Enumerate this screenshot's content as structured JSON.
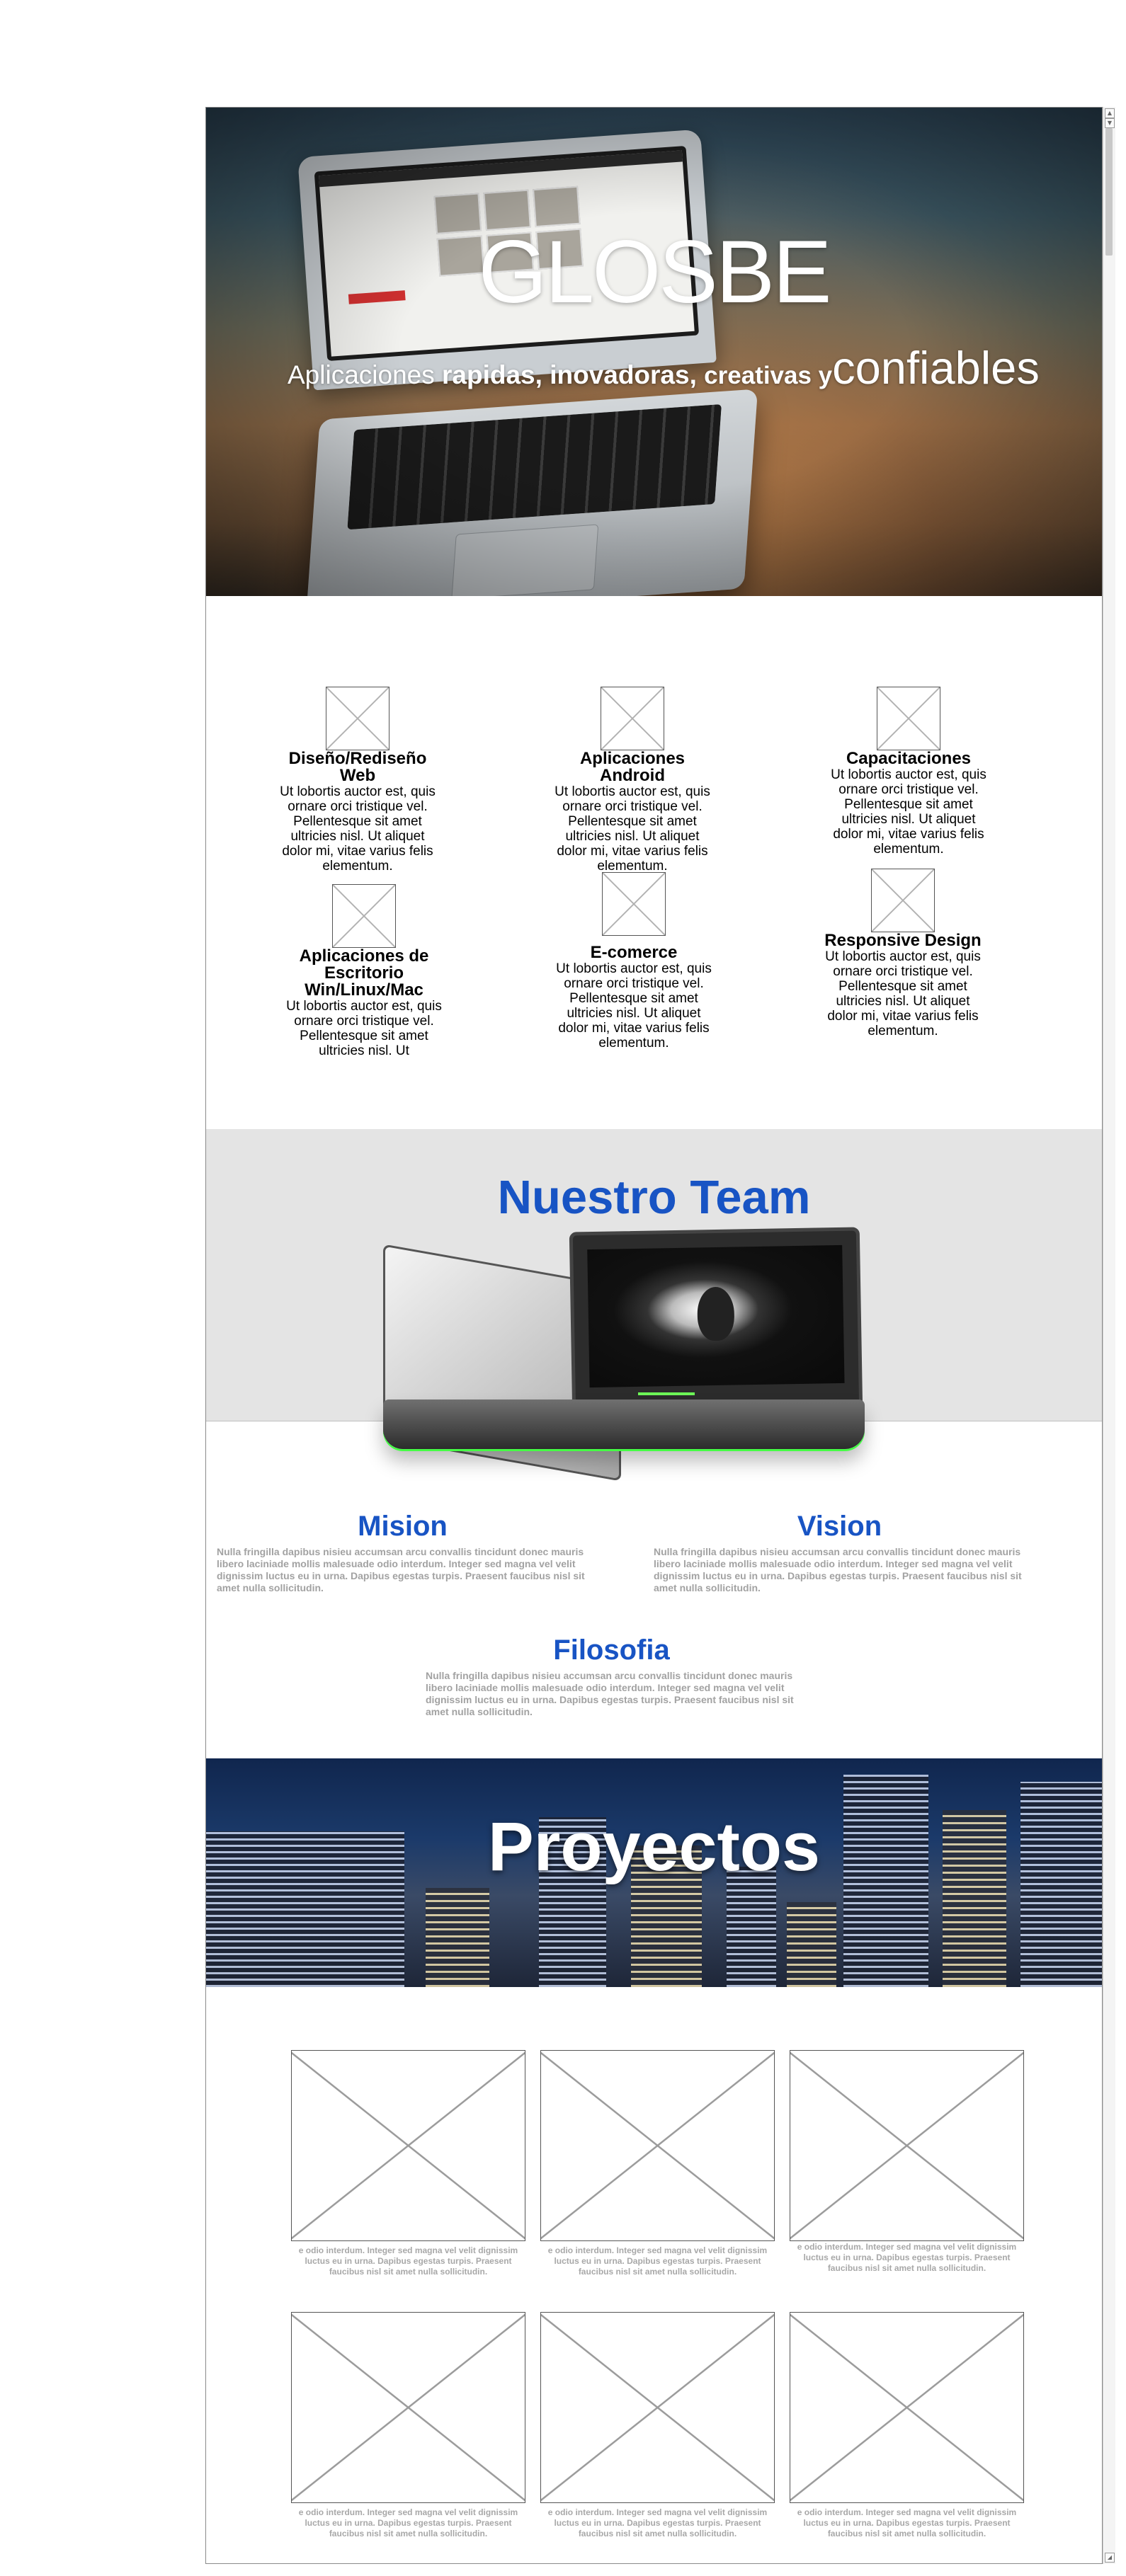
{
  "hero": {
    "title": "GLOSBE",
    "subtitle_part1": "Aplicaciones ",
    "subtitle_part2": "rapidas, inovadoras, ",
    "subtitle_part3": "creativas y",
    "subtitle_part4": "confiables"
  },
  "services": [
    {
      "title": "Diseño/Rediseño Web",
      "text": "Ut lobortis auctor est, quis ornare orci tristique vel. Pellentesque sit amet ultricies nisl. Ut aliquet dolor mi, vitae varius felis elementum."
    },
    {
      "title": "Aplicaciones Android",
      "text": "Ut lobortis auctor est, quis ornare orci tristique vel. Pellentesque sit amet ultricies nisl. Ut aliquet dolor mi, vitae varius felis elementum."
    },
    {
      "title": "Capacitaciones",
      "text": "Ut lobortis auctor est, quis ornare orci tristique vel. Pellentesque sit amet ultricies nisl. Ut aliquet dolor mi, vitae varius felis elementum."
    },
    {
      "title": "Aplicaciones de Escritorio Win/Linux/Mac",
      "text": "Ut lobortis auctor est, quis ornare orci tristique vel. Pellentesque sit amet ultricies nisl. Ut"
    },
    {
      "title": "E-comerce",
      "text": "Ut lobortis auctor est, quis ornare orci tristique vel. Pellentesque sit amet ultricies nisl. Ut aliquet dolor mi, vitae varius felis elementum."
    },
    {
      "title": "Responsive Design",
      "text": "Ut lobortis auctor est, quis ornare orci tristique vel. Pellentesque sit amet ultricies nisl. Ut aliquet dolor mi, vitae varius felis elementum."
    }
  ],
  "team": {
    "title": "Nuestro Team",
    "mision": {
      "title": "Mision",
      "text": "Nulla fringilla dapibus nisieu accumsan arcu convallis tincidunt donec mauris libero laciniade mollis malesuade odio interdum. Integer sed magna vel velit dignissim luctus eu in urna. Dapibus egestas turpis. Praesent faucibus nisl sit amet nulla sollicitudin."
    },
    "vision": {
      "title": "Vision",
      "text": "Nulla fringilla dapibus nisieu accumsan arcu convallis tincidunt donec mauris libero laciniade mollis malesuade odio interdum. Integer sed magna vel velit dignissim luctus eu in urna. Dapibus egestas turpis. Praesent faucibus nisl sit amet nulla sollicitudin."
    },
    "filosofia": {
      "title": "Filosofia",
      "text": "Nulla fringilla dapibus nisieu accumsan arcu convallis tincidunt donec mauris libero laciniade mollis malesuade odio interdum. Integer sed magna vel velit dignissim luctus eu in urna. Dapibus egestas turpis. Praesent faucibus nisl sit amet nulla sollicitudin."
    }
  },
  "projects": {
    "title": "Proyectos",
    "items": [
      {
        "text": "e odio interdum. Integer sed magna vel velit dignissim luctus eu in urna. Dapibus egestas turpis. Praesent faucibus nisl sit amet nulla sollicitudin."
      },
      {
        "text": "e odio interdum. Integer sed magna vel velit dignissim luctus eu in urna. Dapibus egestas turpis. Praesent faucibus nisl sit amet nulla sollicitudin."
      },
      {
        "text": "e odio interdum. Integer sed magna vel velit dignissim luctus eu in urna. Dapibus egestas turpis. Praesent faucibus nisl sit amet nulla sollicitudin."
      },
      {
        "text": "e odio interdum. Integer sed magna vel velit dignissim luctus eu in urna. Dapibus egestas turpis. Praesent faucibus nisl sit amet nulla sollicitudin."
      },
      {
        "text": "e odio interdum. Integer sed magna vel velit dignissim luctus eu in urna. Dapibus egestas turpis. Praesent faucibus nisl sit amet nulla sollicitudin."
      },
      {
        "text": "e odio interdum. Integer sed magna vel velit dignissim luctus eu in urna. Dapibus egestas turpis. Praesent faucibus nisl sit amet nulla sollicitudin."
      }
    ]
  },
  "scrollbar": {
    "up_icon": "arrow-up-icon",
    "down_icon": "arrow-down-icon"
  },
  "colors": {
    "accent": "#1854c4",
    "muted_text": "#a2a2a2",
    "team_band": "#e4e4e4"
  }
}
